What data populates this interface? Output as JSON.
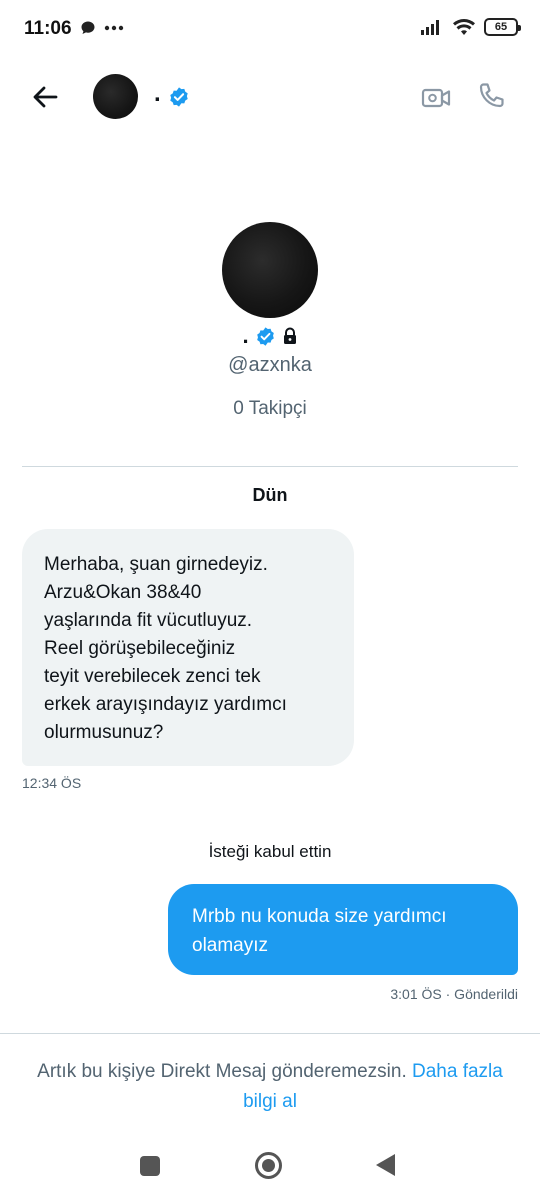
{
  "status_bar": {
    "time": "11:06",
    "battery": "65"
  },
  "header": {
    "name": ".",
    "verified": true
  },
  "profile": {
    "name": ".",
    "handle": "@azxnka",
    "followers": "0 Takipçi"
  },
  "conversation": {
    "date_label": "Dün",
    "incoming": {
      "text": "Merhaba, şuan girnedeyiz.\nArzu&Okan 38&40\nyaşlarında fit vücutluyuz.\nReel görüşebileceğiniz\nteyit verebilecek zenci tek\nerkek arayışındayız yardımcı\nolurmusunuz?",
      "time": "12:34 ÖS"
    },
    "system_note": "İsteği kabul ettin",
    "outgoing": {
      "text": "Mrbb nu konuda size yardımcı\nolamayız",
      "status": "3:01 ÖS · Gönderildi"
    }
  },
  "footer": {
    "notice": "Artık bu kişiye Direkt Mesaj gönderemezsin.",
    "link": "Daha fazla bilgi al"
  },
  "colors": {
    "accent": "#1d9bf0",
    "incoming_bubble": "#eff3f4",
    "secondary_text": "#536471"
  }
}
